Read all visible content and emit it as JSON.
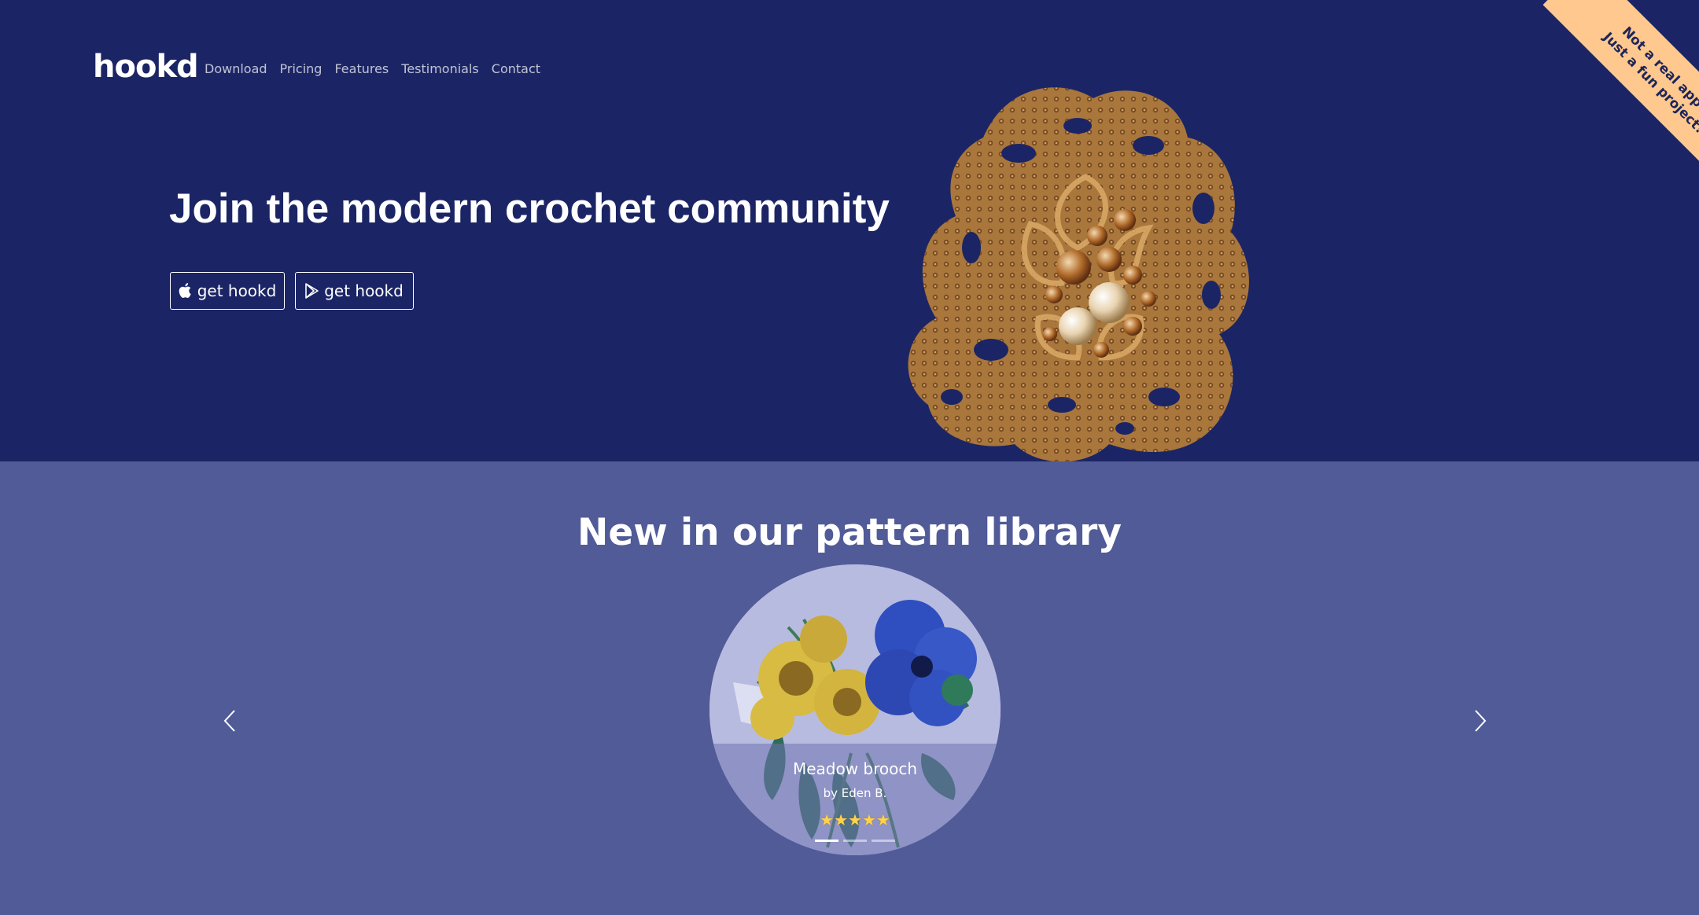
{
  "brand": "hookd",
  "nav": {
    "items": [
      "Download",
      "Pricing",
      "Features",
      "Testimonials",
      "Contact"
    ]
  },
  "hero": {
    "headline": "Join the modern crochet community",
    "buttons": [
      {
        "label": "get hookd",
        "icon": "apple-icon"
      },
      {
        "label": "get hookd",
        "icon": "google-play-icon"
      }
    ]
  },
  "ribbon": {
    "line1": "Not a real app -",
    "line2": "Just a fun project!"
  },
  "library": {
    "title": "New in our pattern library",
    "slide": {
      "title": "Meadow brooch",
      "author": "by Eden B.",
      "rating": 5
    },
    "slide_count": 3,
    "active_slide": 0
  },
  "colors": {
    "hero_bg": "#1b2565",
    "library_bg": "#515b98",
    "ribbon": "#ffc88e",
    "accent_text": "#ffffff"
  }
}
